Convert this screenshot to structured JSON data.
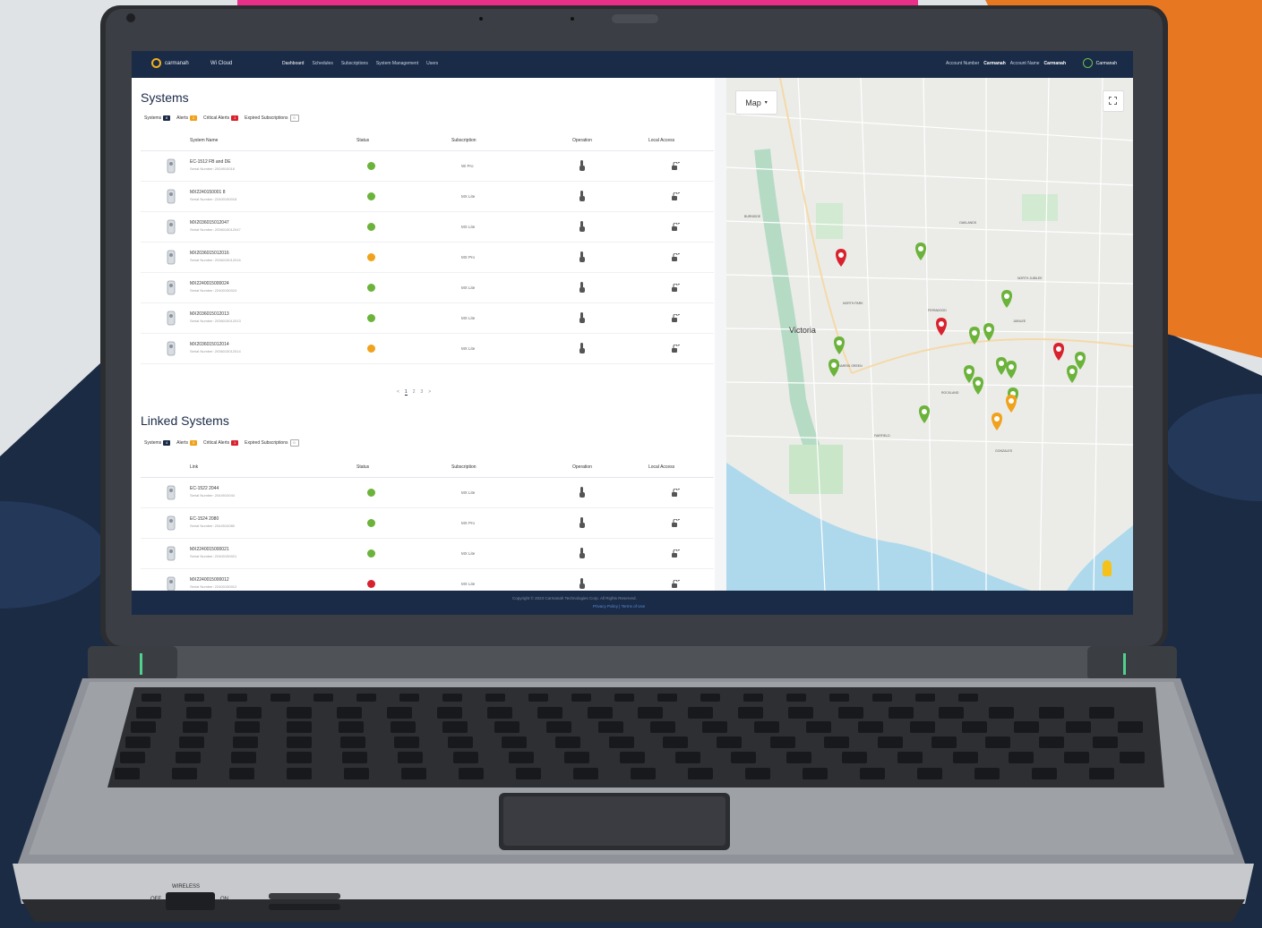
{
  "colors": {
    "navy": "#1a2b47",
    "accent_orange": "#e87722",
    "accent_pink": "#e8308a",
    "ok": "#6bb33a",
    "warn": "#f0a21c",
    "crit": "#d8222e"
  },
  "topbar": {
    "brand": "carmanah",
    "product": "Wi Cloud",
    "nav": [
      "Dashboard",
      "Schedules",
      "Subscriptions",
      "System Management",
      "Users"
    ],
    "account_number_label": "Account Number",
    "account_number_value": "Carmanah",
    "account_name_label": "Account Name",
    "account_name_value": "Carmanah",
    "user": "Carmanah"
  },
  "systems": {
    "title": "Systems",
    "chips": [
      {
        "label": "Systems",
        "count": "8"
      },
      {
        "label": "Alerts",
        "count": "2"
      },
      {
        "label": "Critical Alerts",
        "count": "1"
      },
      {
        "label": "Expired Subscriptions",
        "count": "0"
      }
    ],
    "columns": [
      "System Name",
      "Status",
      "Subscription",
      "Operation",
      "Local Access"
    ],
    "rows": [
      {
        "name": "EC-1512 FB and DE",
        "serial": "Serial Number: 2004910016",
        "status": "ok",
        "subscription": "Wi Pro"
      },
      {
        "name": "MX2240150001 8",
        "serial": "Serial Number: 22400150018",
        "status": "ok",
        "subscription": "MX Lite"
      },
      {
        "name": "MX2036015012047",
        "serial": "Serial Number: 2036015012047",
        "status": "ok",
        "subscription": "MX Lite"
      },
      {
        "name": "MX2036015012016",
        "serial": "Serial Number: 2036015012016",
        "status": "warn",
        "subscription": "MX Pro"
      },
      {
        "name": "MX2240015000024",
        "serial": "Serial Number: 22400150024",
        "status": "ok",
        "subscription": "MX Lite"
      },
      {
        "name": "MX2036015012013",
        "serial": "Serial Number: 2036015012013",
        "status": "ok",
        "subscription": "MX Lite"
      },
      {
        "name": "MX2036015012014",
        "serial": "Serial Number: 2036015012014",
        "status": "warn",
        "subscription": "MX Lite"
      }
    ],
    "pager": [
      "<",
      "1",
      "2",
      "3",
      ">"
    ]
  },
  "linked": {
    "title": "Linked Systems",
    "chips": [
      {
        "label": "Systems",
        "count": "4"
      },
      {
        "label": "Alerts",
        "count": "0"
      },
      {
        "label": "Critical Alerts",
        "count": "1"
      },
      {
        "label": "Expired Subscriptions",
        "count": "0"
      }
    ],
    "columns": [
      "Link",
      "Status",
      "Subscription",
      "Operation",
      "Local Access"
    ],
    "rows": [
      {
        "name": "EC-1522 2044",
        "serial": "Serial Number: 2044910044",
        "status": "ok",
        "subscription": "MX Lite"
      },
      {
        "name": "EC-1524 2080",
        "serial": "Serial Number: 2044910080",
        "status": "ok",
        "subscription": "MX Pro"
      },
      {
        "name": "MX2240015000021",
        "serial": "Serial Number: 22400150021",
        "status": "ok",
        "subscription": "MX Lite"
      },
      {
        "name": "MX2240015000012",
        "serial": "Serial Number: 22400150012",
        "status": "crit",
        "subscription": "MX Lite"
      }
    ]
  },
  "map": {
    "type_button": "Map",
    "city_label": "Victoria",
    "area_labels": [
      "BURNSIDE",
      "OAKLANDS",
      "NORTH PARK",
      "FERNWOOD",
      "JUBILEE",
      "HARRIS GREEN",
      "ROCKLAND",
      "FAIRFIELD",
      "GONZALES",
      "NORTH JUBILEE"
    ]
  },
  "footer": {
    "copyright": "Copyright © 2023 Carmanah Technologies Corp. All Rights Reserved.",
    "links": "Privacy Policy | Terms of Use"
  },
  "keyboard_caps": {
    "wireless": "WIRELESS",
    "off": "OFF",
    "on": "ON"
  }
}
